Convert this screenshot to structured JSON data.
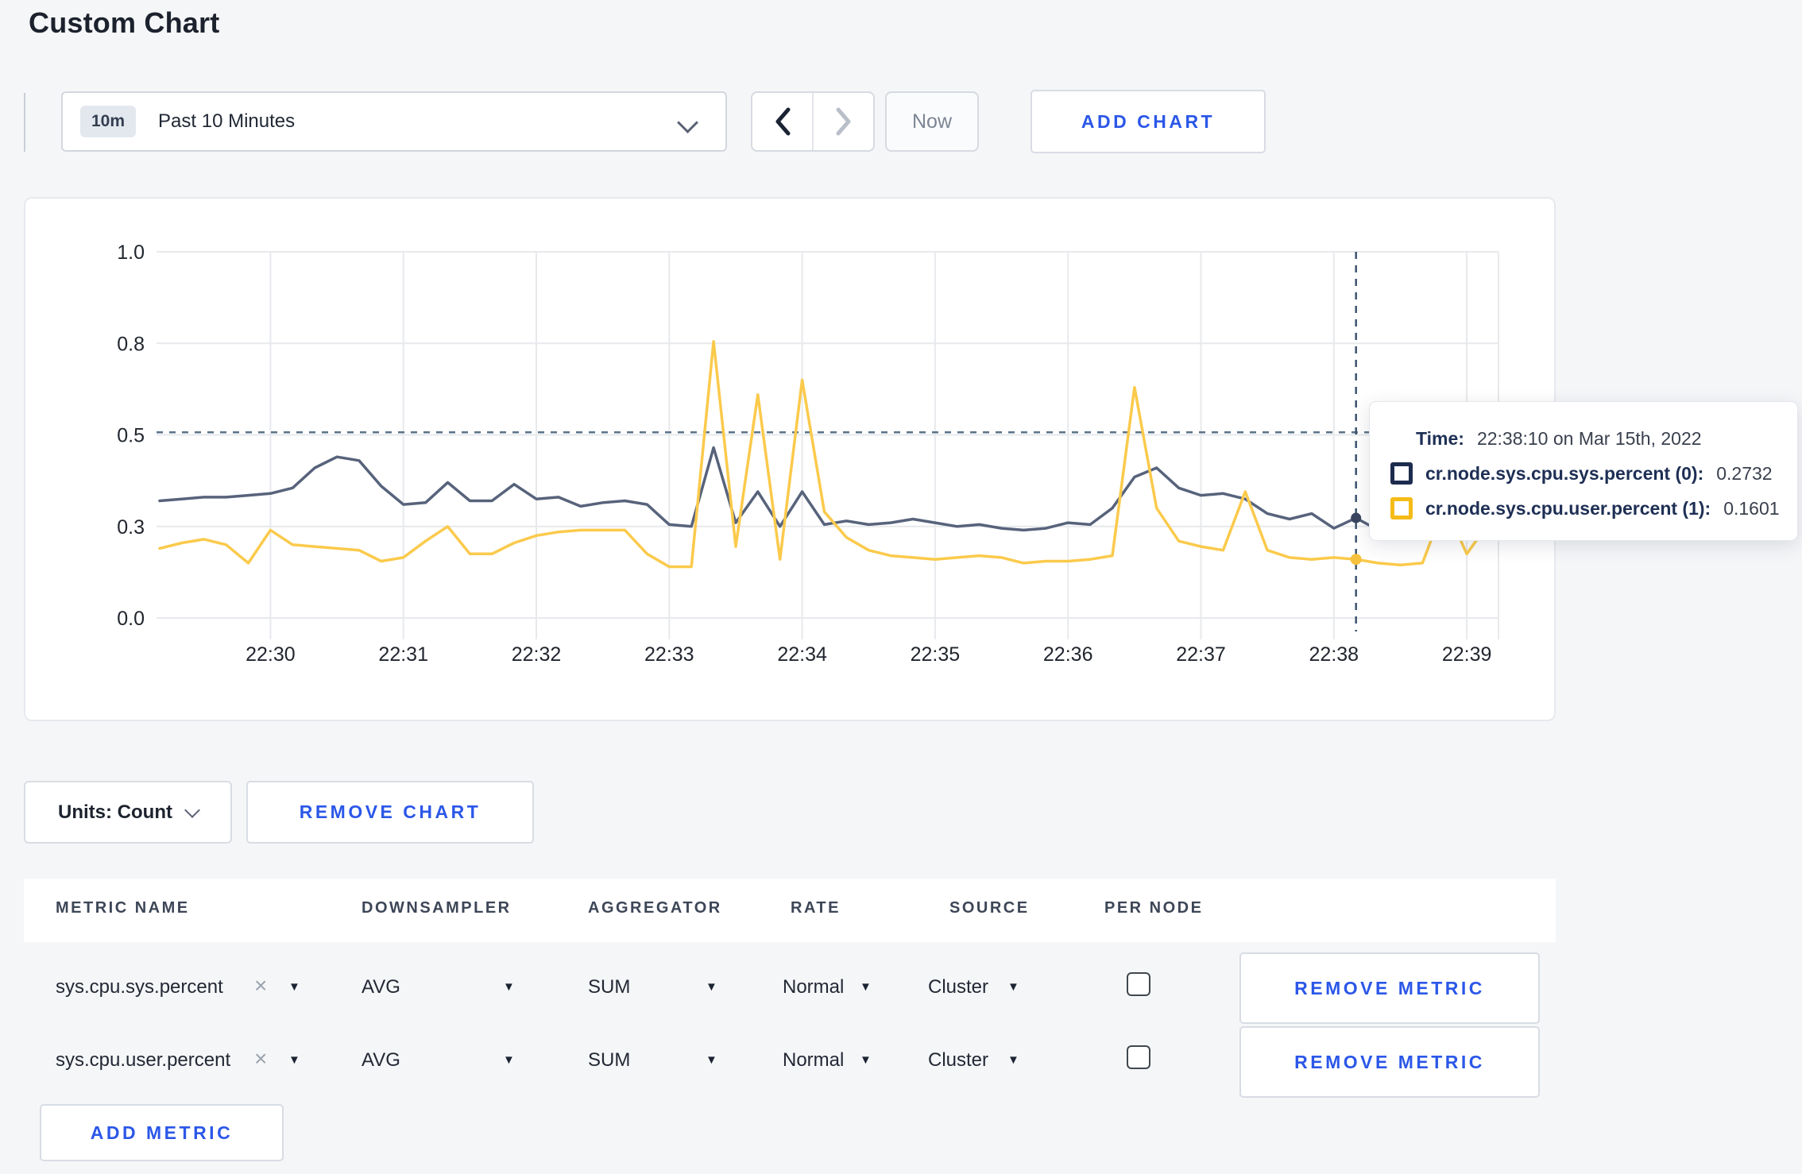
{
  "page": {
    "title": "Custom Chart"
  },
  "colors": {
    "accent_blue": "#2b57e8",
    "series_sys": "#57637b",
    "series_user": "#fbca4c",
    "swatch_sys_border": "#1d2c4e",
    "swatch_user_border": "#f5bb17"
  },
  "toolbar": {
    "time_window_badge": "10m",
    "time_window_label": "Past 10 Minutes",
    "now_label": "Now",
    "add_chart_label": "ADD CHART"
  },
  "chart_controls": {
    "units_label": "Units: Count",
    "remove_chart_label": "REMOVE CHART",
    "add_metric_label": "ADD METRIC"
  },
  "tooltip": {
    "time_label": "Time:",
    "time_value": "22:38:10 on Mar 15th, 2022",
    "rows": [
      {
        "label": "cr.node.sys.cpu.sys.percent (0):",
        "value": "0.2732"
      },
      {
        "label": "cr.node.sys.cpu.user.percent (1):",
        "value": "0.1601"
      }
    ]
  },
  "chart_data": {
    "type": "line",
    "title": "",
    "xlabel": "",
    "ylabel": "",
    "ylim": [
      0,
      1
    ],
    "grid": true,
    "x_start_time": "22:29:10",
    "x_interval_seconds": 10,
    "x_ticks": [
      "22:30",
      "22:31",
      "22:32",
      "22:33",
      "22:34",
      "22:35",
      "22:36",
      "22:37",
      "22:38",
      "22:39"
    ],
    "y_ticks": [
      {
        "value": 0.0,
        "label": "0.0"
      },
      {
        "value": 0.25,
        "label": "0.3"
      },
      {
        "value": 0.5,
        "label": "0.5"
      },
      {
        "value": 0.75,
        "label": "0.8"
      },
      {
        "value": 1.0,
        "label": "1.0"
      }
    ],
    "threshold_line": 0.507,
    "crosshair": {
      "time": "22:38:10",
      "index": 54,
      "sys_value": 0.2732,
      "user_value": 0.1601
    },
    "series": [
      {
        "name": "cr.node.sys.cpu.sys.percent",
        "color": "#57637b",
        "marker_color": "#39455f",
        "values": [
          0.32,
          0.325,
          0.33,
          0.33,
          0.335,
          0.34,
          0.355,
          0.41,
          0.44,
          0.43,
          0.36,
          0.31,
          0.315,
          0.37,
          0.32,
          0.32,
          0.365,
          0.325,
          0.33,
          0.305,
          0.315,
          0.32,
          0.31,
          0.255,
          0.25,
          0.465,
          0.26,
          0.345,
          0.25,
          0.345,
          0.255,
          0.265,
          0.255,
          0.26,
          0.27,
          0.26,
          0.25,
          0.255,
          0.245,
          0.24,
          0.245,
          0.26,
          0.255,
          0.3,
          0.385,
          0.41,
          0.355,
          0.335,
          0.34,
          0.325,
          0.285,
          0.27,
          0.285,
          0.245,
          0.2732,
          0.24,
          0.26,
          0.285,
          0.3,
          0.285,
          0.3
        ]
      },
      {
        "name": "cr.node.sys.cpu.user.percent",
        "color": "#fbca4c",
        "marker_color": "#f6c13c",
        "values": [
          0.19,
          0.205,
          0.215,
          0.2,
          0.15,
          0.24,
          0.2,
          0.195,
          0.19,
          0.185,
          0.155,
          0.165,
          0.21,
          0.25,
          0.175,
          0.175,
          0.205,
          0.225,
          0.235,
          0.24,
          0.24,
          0.24,
          0.175,
          0.14,
          0.14,
          0.755,
          0.195,
          0.61,
          0.16,
          0.65,
          0.29,
          0.22,
          0.185,
          0.17,
          0.165,
          0.16,
          0.165,
          0.17,
          0.165,
          0.15,
          0.155,
          0.155,
          0.16,
          0.17,
          0.63,
          0.3,
          0.21,
          0.195,
          0.185,
          0.345,
          0.185,
          0.165,
          0.16,
          0.165,
          0.1601,
          0.15,
          0.145,
          0.15,
          0.31,
          0.175,
          0.26
        ]
      }
    ]
  },
  "table": {
    "headers": [
      "METRIC NAME",
      "DOWNSAMPLER",
      "AGGREGATOR",
      "RATE",
      "SOURCE",
      "PER NODE"
    ],
    "remove_metric_label": "REMOVE METRIC",
    "rows": [
      {
        "metric": "sys.cpu.sys.percent",
        "downsampler": "AVG",
        "aggregator": "SUM",
        "rate": "Normal",
        "source": "Cluster",
        "per_node_checked": false
      },
      {
        "metric": "sys.cpu.user.percent",
        "downsampler": "AVG",
        "aggregator": "SUM",
        "rate": "Normal",
        "source": "Cluster",
        "per_node_checked": false
      }
    ]
  }
}
